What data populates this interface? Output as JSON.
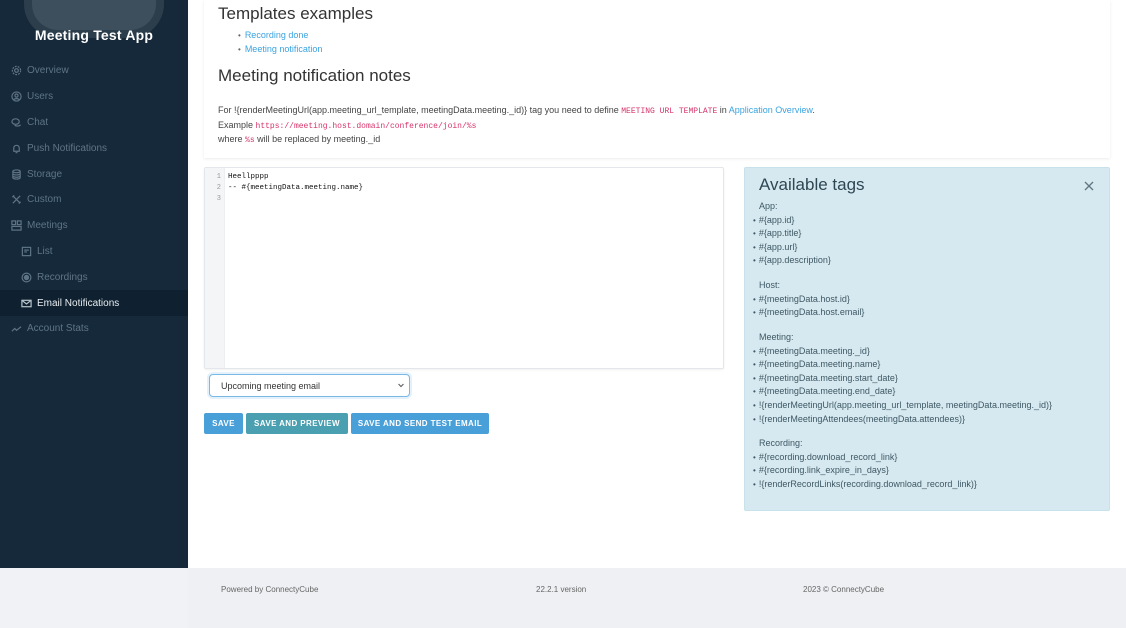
{
  "sidebar": {
    "app_title": "Meeting Test App",
    "items": [
      {
        "label": "Overview",
        "icon": "gear-icon"
      },
      {
        "label": "Users",
        "icon": "user-icon"
      },
      {
        "label": "Chat",
        "icon": "chat-icon"
      },
      {
        "label": "Push Notifications",
        "icon": "bell-icon"
      },
      {
        "label": "Storage",
        "icon": "database-icon"
      },
      {
        "label": "Custom",
        "icon": "tools-icon"
      },
      {
        "label": "Meetings",
        "icon": "meetings-icon"
      },
      {
        "label": "List",
        "icon": "list-icon"
      },
      {
        "label": "Recordings",
        "icon": "record-icon"
      },
      {
        "label": "Email Notifications",
        "icon": "mail-icon"
      },
      {
        "label": "Account Stats",
        "icon": "chart-line-icon"
      }
    ],
    "active_item": "Email Notifications"
  },
  "top": {
    "templates_heading": "Templates examples",
    "templates": [
      "Recording done",
      "Meeting notification"
    ],
    "notes_heading": "Meeting notification notes",
    "note_line1_prefix": "For !{renderMeetingUrl(app.meeting_url_template, meetingData.meeting._id)} tag you need to define ",
    "note_line1_code": "MEETING URL TEMPLATE",
    "note_line1_mid": " in ",
    "note_line1_link": "Application Overview",
    "note_line1_suffix": ".",
    "note_line2_prefix": "Example ",
    "note_line2_code": "https://meeting.host.domain/conference/join/%s",
    "note_line3_prefix": "where ",
    "note_line3_code": "%s",
    "note_line3_suffix": " will be replaced by meeting._id"
  },
  "editor": {
    "line_numbers": [
      "1",
      "2",
      "3"
    ],
    "lines": [
      "Heellpppp",
      "-- #{meetingData.meeting.name}",
      ""
    ]
  },
  "template_select": {
    "selected": "Upcoming meeting email"
  },
  "buttons": {
    "save": "SAVE",
    "save_preview": "SAVE AND PREVIEW",
    "save_send": "SAVE AND SEND TEST EMAIL"
  },
  "tags_panel": {
    "title": "Available tags",
    "close_icon": "close-icon",
    "groups": [
      {
        "title": "App:",
        "tags": [
          "#{app.id}",
          "#{app.title}",
          "#{app.url}",
          "#{app.description}"
        ]
      },
      {
        "title": "Host:",
        "tags": [
          "#{meetingData.host.id}",
          "#{meetingData.host.email}"
        ]
      },
      {
        "title": "Meeting:",
        "tags": [
          "#{meetingData.meeting._id}",
          "#{meetingData.meeting.name}",
          "#{meetingData.meeting.start_date}",
          "#{meetingData.meeting.end_date}",
          "!{renderMeetingUrl(app.meeting_url_template, meetingData.meeting._id)}",
          "!{renderMeetingAttendees(meetingData.attendees)}"
        ]
      },
      {
        "title": "Recording:",
        "tags": [
          "#{recording.download_record_link}",
          "#{recording.link_expire_in_days}",
          "!{renderRecordLinks(recording.download_record_link)}"
        ]
      }
    ]
  },
  "footer": {
    "powered": "Powered by ConnectyCube",
    "version": "22.2.1 version",
    "copyright": "2023 © ConnectyCube"
  }
}
